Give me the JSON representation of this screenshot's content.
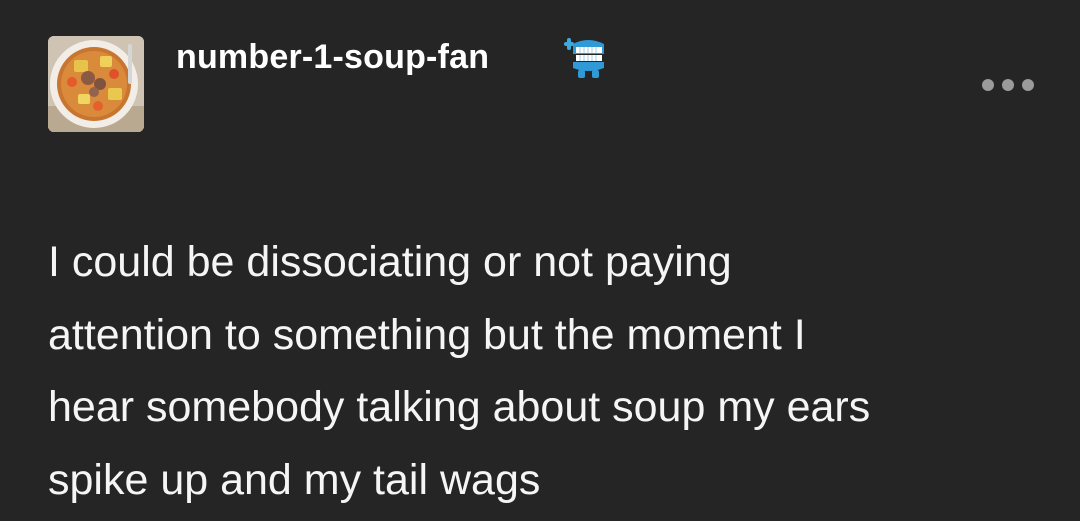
{
  "post": {
    "author": {
      "username": "number-1-soup-fan",
      "avatar_icon": "soup-bowl-avatar",
      "badge_icon": "wind-up-teeth-icon"
    },
    "more_icon": "ellipsis-icon",
    "body_lines": [
      "I could be dissociating or not paying",
      "attention to something but the moment I",
      "hear somebody talking about soup my ears",
      "spike up and my tail wags"
    ]
  },
  "colors": {
    "background": "#252525",
    "text": "#f5f5f5",
    "muted_icon": "#9a9a9a"
  }
}
